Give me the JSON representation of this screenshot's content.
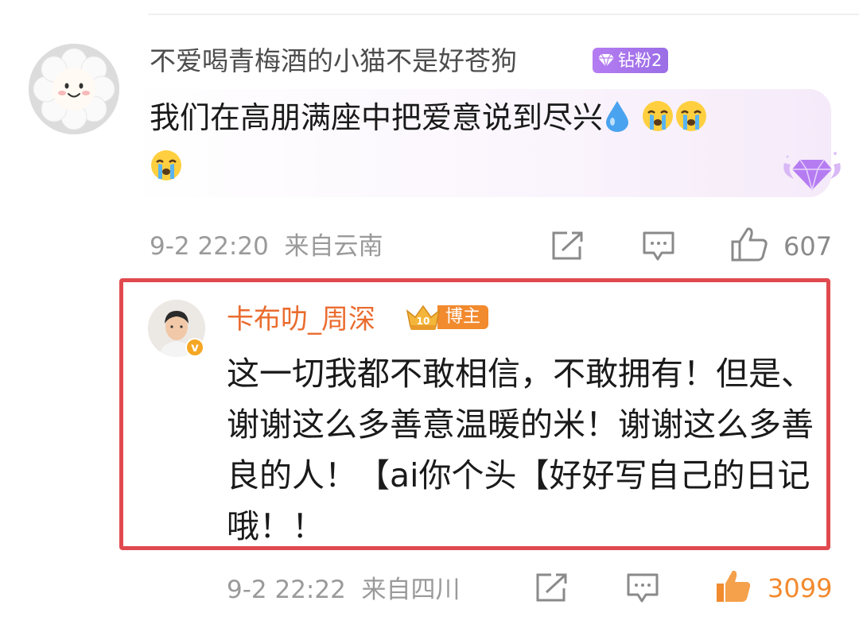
{
  "comment1": {
    "username": "不爱喝青梅酒的小猫不是好苍狗",
    "badge": "钻粉2",
    "text": "我们在高朋满座中把爱意说到尽兴",
    "emojis": [
      "water-drop-icon",
      "crying-face-icon",
      "crying-face-icon",
      "crying-face-icon"
    ],
    "time": "9-2 22:20",
    "location": "来自云南",
    "likes": "607"
  },
  "reply": {
    "username": "卡布叻_周深",
    "badge_level": "10",
    "badge": "博主",
    "text": "这一切我都不敢相信，不敢拥有！但是、谢谢这么多善意温暖的米！谢谢这么多善良的人！【ai你个头【好好写自己的日记哦！！",
    "time": "9-2 22:22",
    "location": "来自四川",
    "likes": "3099"
  },
  "colors": {
    "highlight": "#e04a4f",
    "reply_username": "#ea6c2f",
    "liked": "#f28a2e",
    "meta": "#9a9a9a"
  }
}
